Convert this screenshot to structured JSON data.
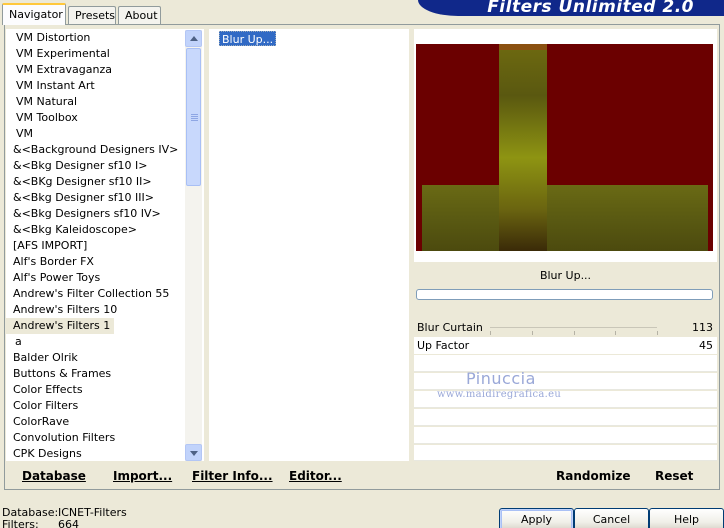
{
  "tabs": [
    {
      "label": "Navigator",
      "active": true
    },
    {
      "label": "Presets",
      "active": false
    },
    {
      "label": "About",
      "active": false
    }
  ],
  "banner": {
    "title": "Filters Unlimited 2.0",
    "color": "#10288a"
  },
  "categories": [
    "VM Distortion",
    "VM Experimental",
    "VM Extravaganza",
    "VM Instant Art",
    "VM Natural",
    "VM Toolbox",
    "VM",
    "&<Background Designers IV>",
    "&<Bkg Designer sf10 I>",
    "&<BKg Designer sf10 II>",
    "&<Bkg Designer sf10 III>",
    "&<Bkg Designers sf10 IV>",
    "&<Bkg Kaleidoscope>",
    "[AFS IMPORT]",
    "Alf's Border FX",
    "Alf's Power Toys",
    "Andrew's Filter Collection 55",
    "Andrew's Filters 10",
    "Andrew's Filters 1",
    "a",
    "Balder Olrik",
    "Buttons & Frames",
    "Color Effects",
    "Color Filters",
    "ColorRave",
    "Convolution Filters",
    "CPK Designs"
  ],
  "selected_category_index": 18,
  "filters": [
    "Blur Up..."
  ],
  "preview": {
    "filter_name": "Blur Up...",
    "background_color": "#6b0000",
    "bar_color": "#8a8a10"
  },
  "params": [
    {
      "name": "Blur Curtain",
      "value": "113"
    },
    {
      "name": "Up Factor",
      "value": "45"
    }
  ],
  "watermark": {
    "line1": "Pinuccia",
    "line2": "www.maidiregrafica.eu"
  },
  "bottom_buttons": {
    "database": "Database",
    "import": "Import...",
    "filter_info": "Filter Info...",
    "editor": "Editor...",
    "randomize": "Randomize",
    "reset": "Reset"
  },
  "status": {
    "database_label": "Database:",
    "database_value": "ICNET-Filters",
    "filters_label": "Filters:",
    "filters_value": "664"
  },
  "dialog_buttons": {
    "apply": "Apply",
    "cancel": "Cancel",
    "help": "Help"
  }
}
